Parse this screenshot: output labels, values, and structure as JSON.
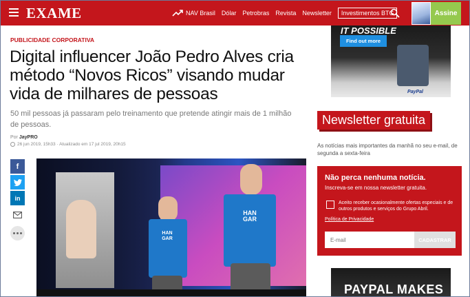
{
  "header": {
    "logo": "EXAME",
    "nav": [
      "NAV Brasil",
      "Dólar",
      "Petrobras",
      "Revista",
      "Newsletter",
      "Investimentos BTG"
    ],
    "subscribe_label": "Assine"
  },
  "article": {
    "kicker": "PUBLICIDADE CORPORATIVA",
    "headline": "Digital influencer João Pedro Alves cria método “Novos Ricos” visando mudar vida de milhares de pessoas",
    "subtitle": "50 mil pessoas já passaram pelo treinamento que pretende atingir mais de 1 milhão de pessoas.",
    "byline_prefix": "Por",
    "author": "JayPRO",
    "dateline": "26 jun 2019, 15h33 · Atualizado em 17 jul 2019, 20h15",
    "shirt_text": "HAN GAR"
  },
  "share": {
    "icons": [
      "facebook-icon",
      "twitter-icon",
      "linkedin-icon",
      "mail-icon",
      "more-icon"
    ]
  },
  "ads": {
    "top_headline": "IT POSSIBLE",
    "top_button": "Find out more",
    "top_brand": "PayPal",
    "bottom_text": "PAYPAL MAKES"
  },
  "newsletter": {
    "title": "Newsletter gratuita",
    "description": "As notícias mais importantes da manhã no seu e-mail, de segunda a sexta-feira",
    "box_heading": "Não perca nenhuma notícia.",
    "box_subheading": "Inscreva-se em nossa newsletter gratuita.",
    "consent": "Aceito receber ocasionalmente ofertas especiais e de outros produtos e serviços do Grupo Abril.",
    "privacy": "Política de Privacidade",
    "email_placeholder": "E-mail",
    "submit": "CADASTRAR"
  },
  "colors": {
    "brand_red": "#c4161c",
    "subscribe_green": "#95c94e",
    "facebook": "#3b5998",
    "twitter": "#1da1f2",
    "linkedin": "#0077b5"
  }
}
